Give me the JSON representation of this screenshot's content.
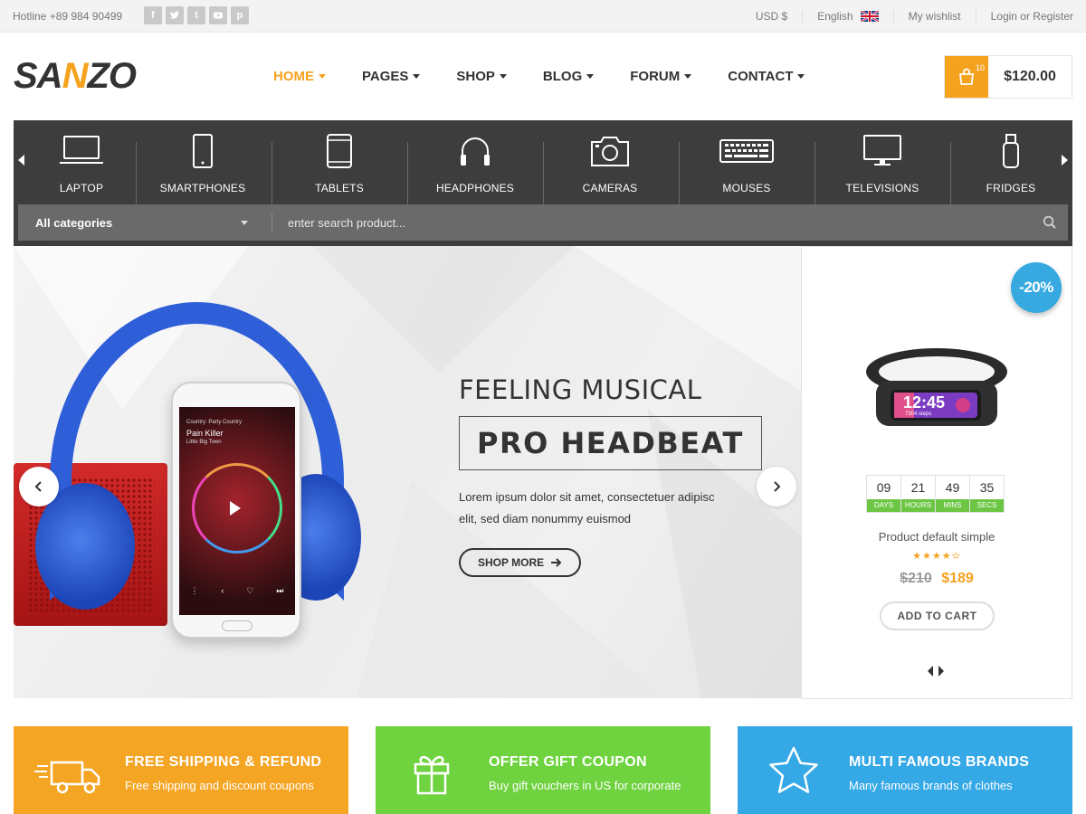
{
  "topbar": {
    "hotline": "Hotline +89 984 90499",
    "socials": [
      {
        "icon": "facebook-icon",
        "glyph": "f"
      },
      {
        "icon": "twitter-icon",
        "glyph": "t"
      },
      {
        "icon": "tumblr-icon",
        "glyph": "t"
      },
      {
        "icon": "youtube-icon",
        "glyph": "▶"
      },
      {
        "icon": "pinterest-icon",
        "glyph": "p"
      }
    ],
    "currency": "USD $",
    "language": "English",
    "wishlist": "My wishlist",
    "account": "Login or Register"
  },
  "header": {
    "logo_start": "SA",
    "logo_accent": "N",
    "logo_end": "ZO",
    "nav": [
      "HOME",
      "PAGES",
      "SHOP",
      "BLOG",
      "FORUM",
      "CONTACT"
    ],
    "active_nav": "HOME",
    "cart_count": "10",
    "cart_total": "$120.00"
  },
  "categories": {
    "items": [
      {
        "label": "LAPTOP",
        "icon": "laptop-icon"
      },
      {
        "label": "SMARTPHONES",
        "icon": "smartphone-icon"
      },
      {
        "label": "TABLETS",
        "icon": "tablet-icon"
      },
      {
        "label": "HEADPHONES",
        "icon": "headphones-icon"
      },
      {
        "label": "CAMERAS",
        "icon": "camera-icon"
      },
      {
        "label": "MOUSES",
        "icon": "keyboard-icon"
      },
      {
        "label": "TELEVISIONS",
        "icon": "monitor-icon"
      },
      {
        "label": "FRIDGES",
        "icon": "usb-drive-icon"
      }
    ],
    "select_value": "All categories",
    "search_placeholder": "enter search product..."
  },
  "hero": {
    "subtitle": "FEELING MUSICAL",
    "title": "PRO HEADBEAT",
    "description": "Lorem ipsum dolor sit amet, consectetuer adipisc elit, sed diam nonummy euismod",
    "button": "SHOP MORE",
    "phone_country": "Country: Party Country",
    "phone_song": "Pain Killer",
    "phone_album": "Little Big Town"
  },
  "deal": {
    "discount": "-20%",
    "watch_time": "12:45",
    "watch_steps": "7304 steps",
    "countdown": [
      {
        "value": "09",
        "label": "DAYS"
      },
      {
        "value": "21",
        "label": "HOURS"
      },
      {
        "value": "49",
        "label": "MINS"
      },
      {
        "value": "35",
        "label": "SECS"
      }
    ],
    "name": "Product default simple",
    "rating": 4.5,
    "stars": "★★★★✫",
    "old_price": "$210",
    "new_price": "$189",
    "button": "ADD TO CART"
  },
  "features": [
    {
      "title": "FREE SHIPPING & REFUND",
      "desc": "Free shipping and discount coupons",
      "color": "#f5a524",
      "icon": "delivery-truck-icon"
    },
    {
      "title": "OFFER GIFT COUPON",
      "desc": "Buy gift vouchers in US for corporate",
      "color": "#6fd23f",
      "icon": "gift-icon"
    },
    {
      "title": "MULTI FAMOUS BRANDS",
      "desc": "Many famous brands of clothes",
      "color": "#35a8e6",
      "icon": "star-icon"
    }
  ],
  "colors": {
    "accent": "#f5a21f",
    "dark_bar": "#3d3d3d",
    "discount": "#36a9e1",
    "countdown_label": "#6cc644"
  }
}
